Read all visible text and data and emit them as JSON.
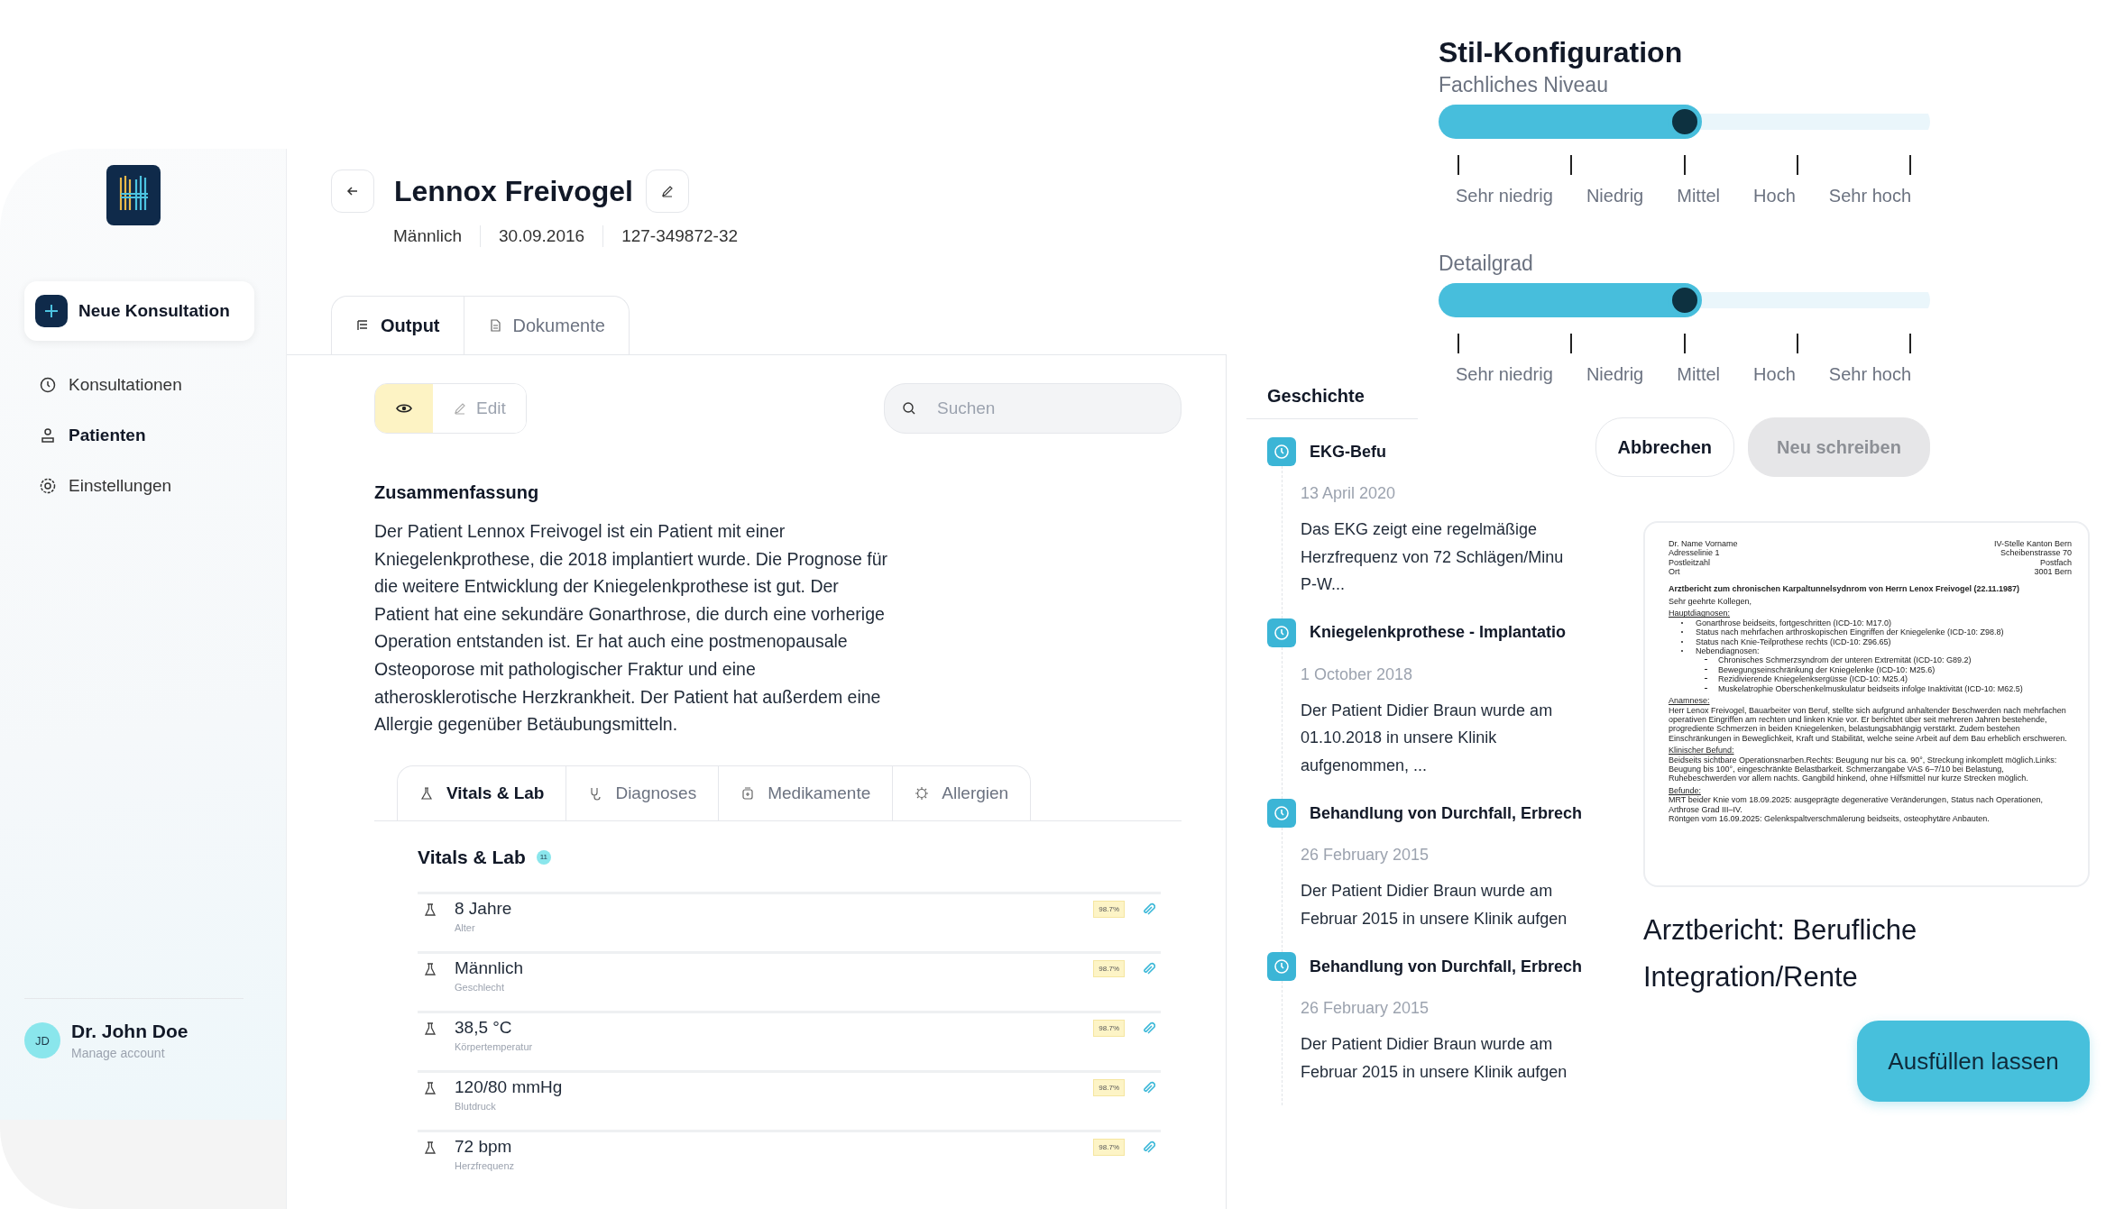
{
  "sidebar": {
    "new_button": "Neue Konsultation",
    "nav_items": [
      {
        "label": "Konsultationen",
        "selected": false
      },
      {
        "label": "Patienten",
        "selected": true
      },
      {
        "label": "Einstellungen",
        "selected": false
      }
    ],
    "user": {
      "initials": "JD",
      "name": "Dr. John Doe",
      "subtitle": "Manage account"
    }
  },
  "patient": {
    "name": "Lennox Freivogel",
    "meta": [
      "Männlich",
      "30.09.2016",
      "127-349872-32"
    ]
  },
  "main_tabs": [
    {
      "label": "Output",
      "selected": true
    },
    {
      "label": "Dokumente",
      "selected": false
    }
  ],
  "modes": [
    {
      "kind": "view",
      "selected": true
    },
    {
      "kind": "edit",
      "label": "Edit",
      "selected": false
    }
  ],
  "search": {
    "placeholder": "Suchen"
  },
  "summary": {
    "title": "Zusammenfassung",
    "text": "Der Patient Lennox Freivogel ist ein Patient mit einer Kniegelenkprothese, die 2018 implantiert wurde. Die Prognose für die weitere Entwicklung der Kniegelenkprothese ist gut. Der Patient hat eine sekundäre Gonarthrose, die durch eine vorherige Operation entstanden ist. Er hat auch eine postmenopausale Osteoporose mit pathologischer Fraktur und eine atherosklerotische Herzkrankheit. Der Patient hat außerdem eine Allergie gegenüber Betäubungsmitteln."
  },
  "section_tabs": [
    {
      "label": "Vitals & Lab",
      "selected": true
    },
    {
      "label": "Diagnoses",
      "selected": false
    },
    {
      "label": "Medikamente",
      "selected": false
    },
    {
      "label": "Allergien",
      "selected": false
    }
  ],
  "vitals": {
    "title": "Vitals & Lab",
    "count": "11",
    "rows": [
      {
        "value": "8 Jahre",
        "label": "Alter",
        "confidence": "98.7%"
      },
      {
        "value": "Männlich",
        "label": "Geschlecht",
        "confidence": "98.7%"
      },
      {
        "value": "38,5 °C",
        "label": "Körpertemperatur",
        "confidence": "98.7%"
      },
      {
        "value": "120/80 mmHg",
        "label": "Blutdruck",
        "confidence": "98.7%"
      },
      {
        "value": "72 bpm",
        "label": "Herzfrequenz",
        "confidence": "98.7%"
      }
    ]
  },
  "history": {
    "title": "Geschichte",
    "items": [
      {
        "title": "EKG-Befu",
        "date": "13 April 2020",
        "lines": [
          "Das EKG zeigt eine regelmäßige",
          "Herzfrequenz von 72 Schlägen/Minu",
          "P-W..."
        ]
      },
      {
        "title": "Kniegelenkprothese - Implantatio",
        "date": "1 October 2018",
        "lines": [
          "Der Patient Didier Braun wurde am",
          "01.10.2018 in unsere Klinik",
          "aufgenommen, ..."
        ]
      },
      {
        "title": "Behandlung von Durchfall, Erbrech",
        "date": "26 February 2015",
        "lines": [
          "Der Patient Didier Braun wurde am",
          "Februar 2015 in unsere Klinik aufgen"
        ]
      },
      {
        "title": "Behandlung von Durchfall, Erbrech",
        "date": "26 February 2015",
        "lines": [
          "Der Patient Didier Braun wurde am",
          "Februar 2015 in unsere Klinik aufgen"
        ]
      }
    ]
  },
  "style_config": {
    "title": "Stil-Konfiguration",
    "sliders": [
      {
        "label": "Fachliches Niveau",
        "level": 0.5,
        "ticks": [
          "Sehr niedrig",
          "Niedrig",
          "Mittel",
          "Hoch",
          "Sehr hoch"
        ]
      },
      {
        "label": "Detailgrad",
        "level": 0.5,
        "ticks": [
          "Sehr niedrig",
          "Niedrig",
          "Mittel",
          "Hoch",
          "Sehr hoch"
        ]
      }
    ],
    "buttons": [
      {
        "label": "Abbrechen",
        "disabled": false
      },
      {
        "label": "Neu schreiben",
        "disabled": true
      }
    ]
  },
  "document": {
    "preview": {
      "sender": [
        "Dr. Name Vorname",
        "Adresselinie 1",
        "Postleitzahl",
        "Ort"
      ],
      "recipient": [
        "IV-Stelle Kanton Bern",
        "Scheibenstrasse 70",
        "Postfach",
        "3001 Bern"
      ],
      "subject": "Arztbericht zum chronischen Karpaltunnelsydnrom von Herrn Lenox Freivogel (22.11.1987)",
      "greeting": "Sehr geehrte Kollegen,",
      "sections": [
        {
          "heading": "Hauptdiagnosen:",
          "bullets": [
            {
              "text": "Gonarthrose beidseits, fortgeschritten (ICD-10: M17.0)"
            },
            {
              "text": "Status nach mehrfachen arthroskopischen Eingriffen der Kniegelenke (ICD-10: Z98.8)"
            },
            {
              "text": "Status nach Knie-Teilprothese rechts (ICD-10: Z96.65)"
            },
            {
              "text": "Nebendiagnosen:",
              "children": [
                "Chronisches Schmerzsyndrom der unteren Extremität (ICD-10: G89.2)",
                "Bewegungseinschränkung der Kniegelenke (ICD-10: M25.6)",
                "Rezidivierende Kniegelenksergüsse (ICD-10: M25.4)",
                "Muskelatrophie Oberschenkelmuskulatur beidseits infolge Inaktivität (ICD-10: M62.5)"
              ]
            }
          ]
        },
        {
          "heading": "Anamnese:",
          "paragraphs": [
            "Herr Lenox Freivogel, Bauarbeiter von Beruf, stellte sich aufgrund anhaltender Beschwerden nach mehrfachen operativen Eingriffen am rechten und linken Knie vor. Er berichtet über seit mehreren Jahren bestehende, progrediente Schmerzen in beiden Kniegelenken, belastungsabhängig verstärkt. Zudem bestehen Einschränkungen in Beweglichkeit, Kraft und Stabilität, welche seine Arbeit auf dem Bau erheblich erschweren."
          ]
        },
        {
          "heading": "Klinischer Befund:",
          "paragraphs": [
            "Beidseits sichtbare Operationsnarben.Rechts: Beugung nur bis ca. 90°, Streckung inkomplett möglich.Links: Beugung bis 100°, eingeschränkte Belastbarkeit. Schmerzangabe VAS 6–7/10 bei Belastung, Ruhebeschwerden vor allem nachts. Gangbild hinkend, ohne Hilfsmittel nur kurze Strecken möglich."
          ]
        },
        {
          "heading": "Befunde:",
          "paragraphs": [
            "MRT beider Knie vom 18.09.2025: ausgeprägte degenerative Veränderungen, Status nach Operationen, Arthrose Grad III–IV.",
            "Röntgen vom 16.09.2025: Gelenkspaltverschmälerung beidseits, osteophytäre Anbauten."
          ]
        }
      ]
    },
    "title": "Arztbericht: Berufliche Integration/Rente",
    "action": "Ausfüllen lassen"
  }
}
